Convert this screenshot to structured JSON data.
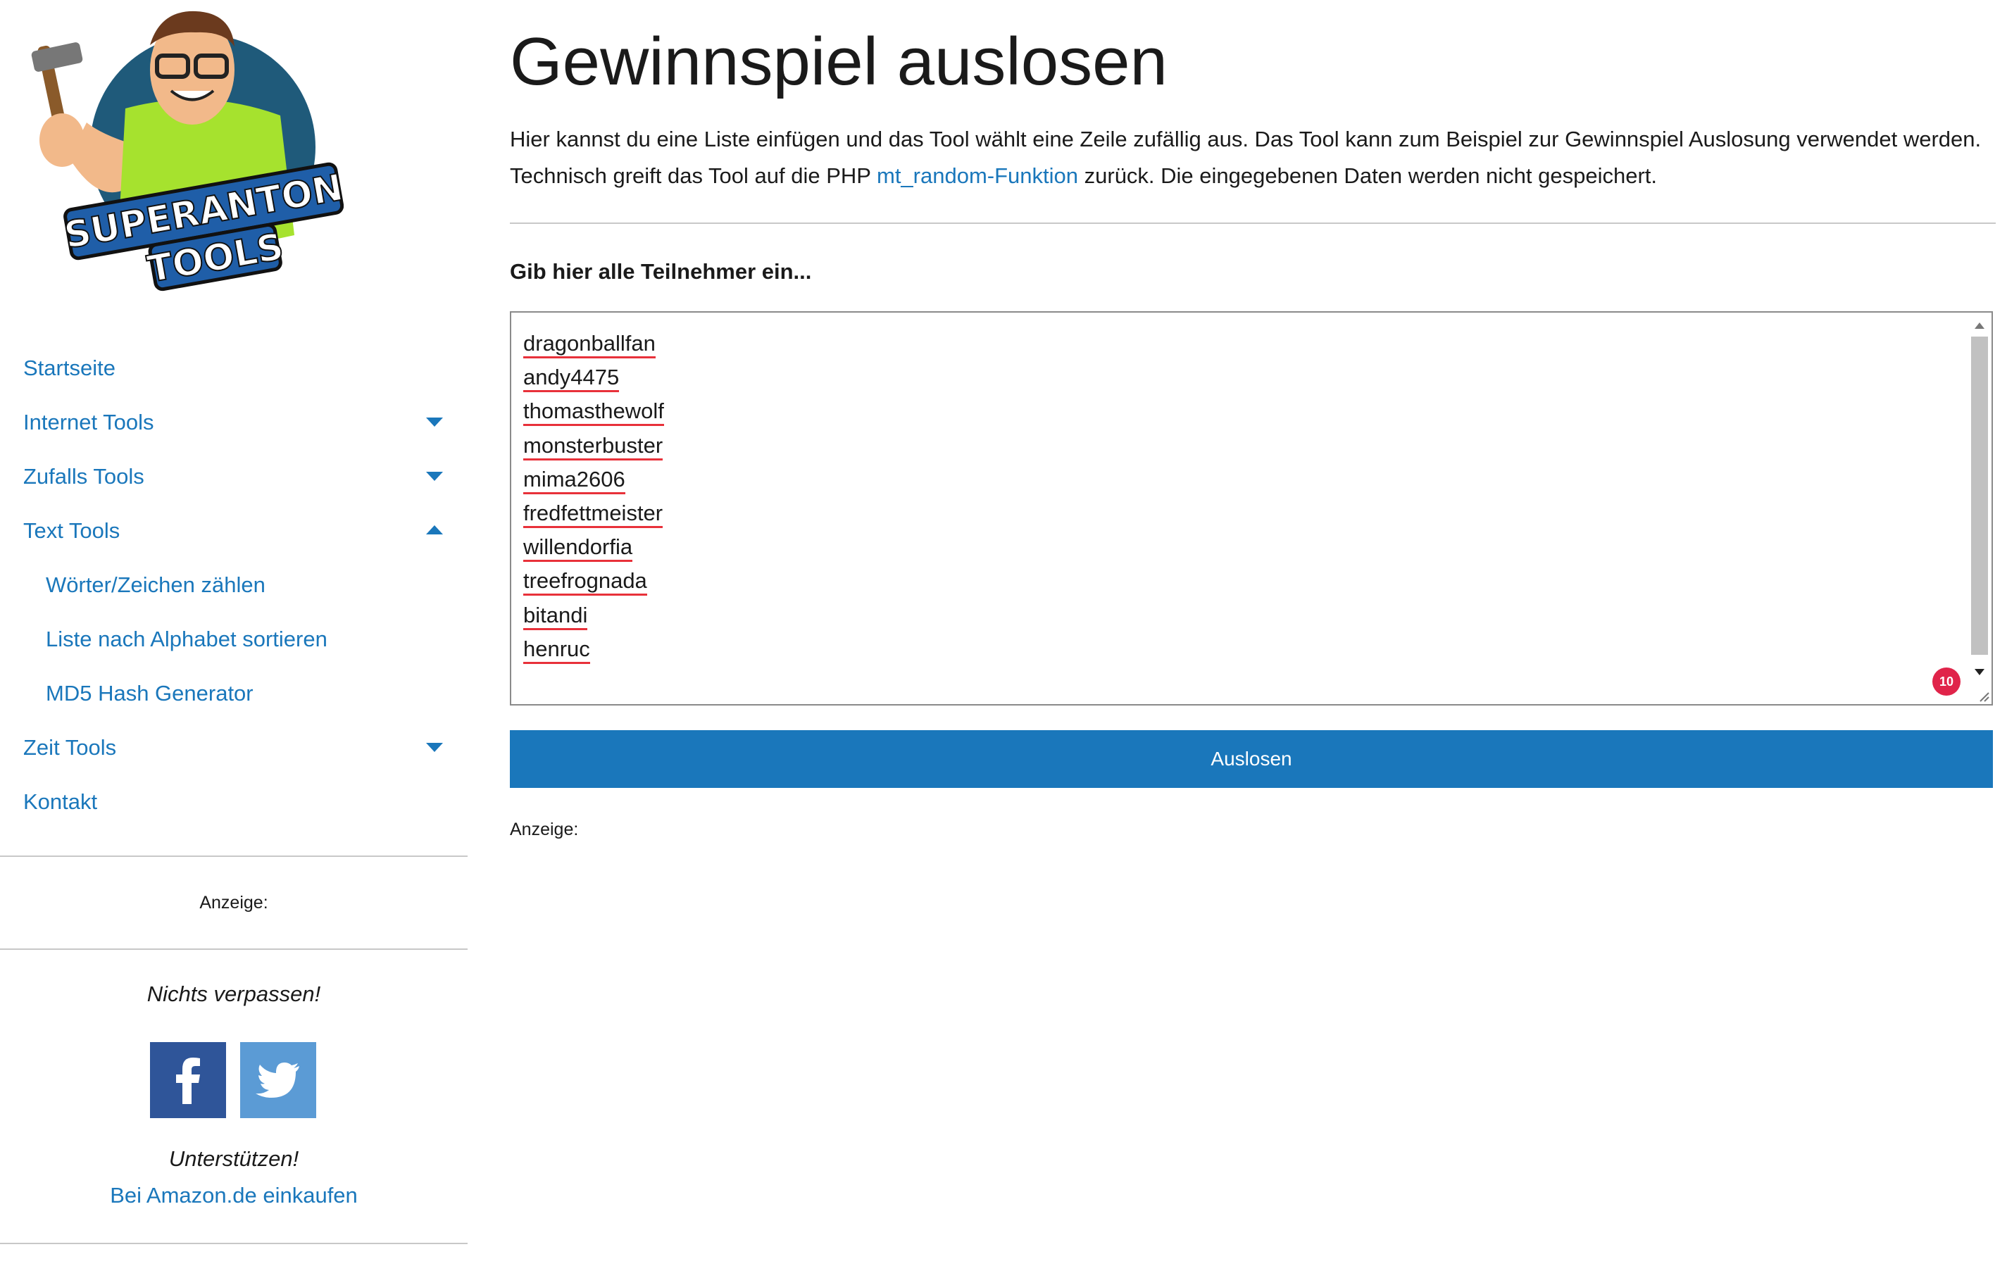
{
  "logo": {
    "line1": "SUPERANTON",
    "line2": "TOOLS"
  },
  "nav": [
    {
      "label": "Startseite",
      "caret": "none"
    },
    {
      "label": "Internet Tools",
      "caret": "down"
    },
    {
      "label": "Zufalls Tools",
      "caret": "down"
    },
    {
      "label": "Text Tools",
      "caret": "up"
    },
    {
      "label": "Wörter/Zeichen zählen",
      "caret": "none",
      "sub": true
    },
    {
      "label": "Liste nach Alphabet sortieren",
      "caret": "none",
      "sub": true
    },
    {
      "label": "MD5 Hash Generator",
      "caret": "none",
      "sub": true
    },
    {
      "label": "Zeit Tools",
      "caret": "down"
    },
    {
      "label": "Kontakt",
      "caret": "none"
    }
  ],
  "sidebar": {
    "ad_label": "Anzeige:",
    "follow_heading": "Nichts verpassen!",
    "support_heading": "Unterstützen!",
    "amazon_link": "Bei Amazon.de einkaufen"
  },
  "main": {
    "title": "Gewinnspiel auslosen",
    "intro_part1": "Hier kannst du eine Liste einfügen und das Tool wählt eine Zeile zufällig aus. Das Tool kann zum Beispiel zur Gewinnspiel Auslosung verwendet werden. Technisch greift das Tool auf die PHP ",
    "intro_link": "mt_random-Funktion",
    "intro_part2": " zurück. Die eingegebenen Daten werden nicht gespeichert.",
    "field_label": "Gib hier alle Teilnehmer ein...",
    "entries": [
      "dragonballfan",
      "andy4475",
      "thomasthewolf",
      "monsterbuster",
      "mima2606",
      "fredfettmeister",
      "willendorfia",
      "treefrognada",
      "bitandi",
      "henruc"
    ],
    "entry_count": "10",
    "button_label": "Auslosen",
    "ad_label": "Anzeige:"
  },
  "colors": {
    "accent": "#1a77bb",
    "spellcheck": "#e8313a",
    "badge": "#e0244a",
    "facebook": "#2f5599",
    "twitter": "#5b9bd5"
  },
  "icons": {
    "facebook": "facebook-icon",
    "twitter": "twitter-icon"
  }
}
